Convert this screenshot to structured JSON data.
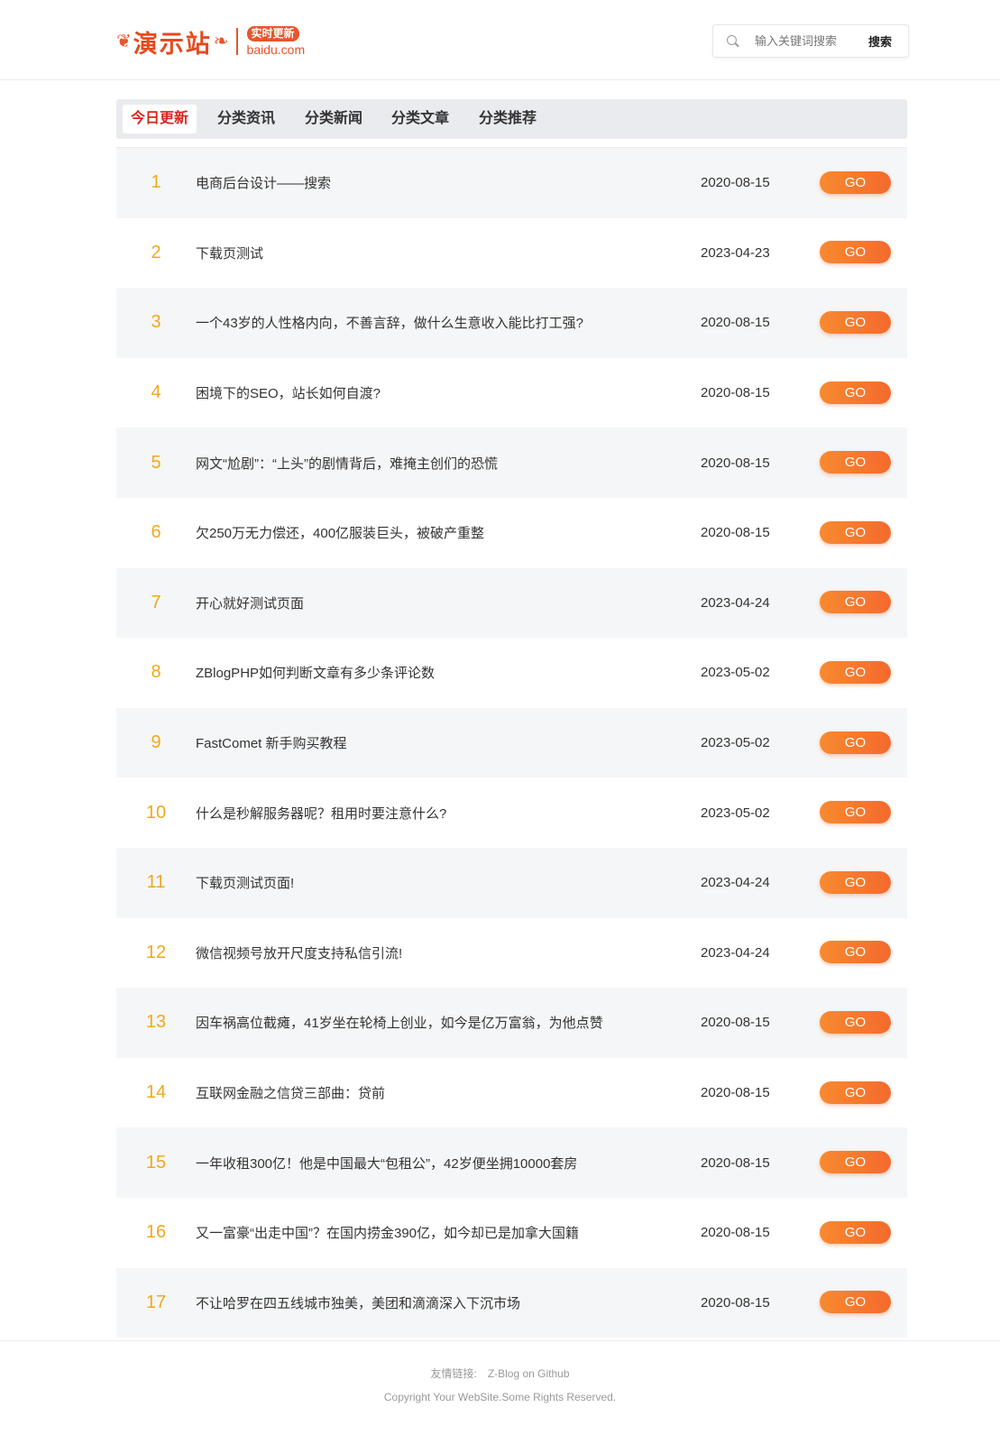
{
  "header": {
    "logo_text": "演示站",
    "logo_badge": "实时更新",
    "logo_domain": "baidu.com",
    "search_placeholder": "输入关键词搜索",
    "search_button": "搜索"
  },
  "tabs": [
    {
      "label": "今日更新",
      "active": true
    },
    {
      "label": "分类资讯",
      "active": false
    },
    {
      "label": "分类新闻",
      "active": false
    },
    {
      "label": "分类文章",
      "active": false
    },
    {
      "label": "分类推荐",
      "active": false
    }
  ],
  "articles": [
    {
      "rank": "1",
      "title": "电商后台设计——搜索",
      "date": "2020-08-15",
      "button": "GO"
    },
    {
      "rank": "2",
      "title": "下载页测试",
      "date": "2023-04-23",
      "button": "GO"
    },
    {
      "rank": "3",
      "title": "一个43岁的人性格内向，不善言辞，做什么生意收入能比打工强?",
      "date": "2020-08-15",
      "button": "GO"
    },
    {
      "rank": "4",
      "title": "困境下的SEO，站长如何自渡?",
      "date": "2020-08-15",
      "button": "GO"
    },
    {
      "rank": "5",
      "title": "网文“尬剧”：“上头”的剧情背后，难掩主创们的恐慌",
      "date": "2020-08-15",
      "button": "GO"
    },
    {
      "rank": "6",
      "title": "欠250万无力偿还，400亿服装巨头，被破产重整",
      "date": "2020-08-15",
      "button": "GO"
    },
    {
      "rank": "7",
      "title": "开心就好测试页面",
      "date": "2023-04-24",
      "button": "GO"
    },
    {
      "rank": "8",
      "title": "ZBlogPHP如何判断文章有多少条评论数",
      "date": "2023-05-02",
      "button": "GO"
    },
    {
      "rank": "9",
      "title": "FastComet 新手购买教程",
      "date": "2023-05-02",
      "button": "GO"
    },
    {
      "rank": "10",
      "title": "什么是秒解服务器呢？租用时要注意什么?",
      "date": "2023-05-02",
      "button": "GO"
    },
    {
      "rank": "11",
      "title": "下载页测试页面!",
      "date": "2023-04-24",
      "button": "GO"
    },
    {
      "rank": "12",
      "title": "微信视频号放开尺度支持私信引流!",
      "date": "2023-04-24",
      "button": "GO"
    },
    {
      "rank": "13",
      "title": "因车祸高位截瘫，41岁坐在轮椅上创业，如今是亿万富翁，为他点赞",
      "date": "2020-08-15",
      "button": "GO"
    },
    {
      "rank": "14",
      "title": "互联网金融之信贷三部曲：贷前",
      "date": "2020-08-15",
      "button": "GO"
    },
    {
      "rank": "15",
      "title": "一年收租300亿！他是中国最大“包租公”，42岁便坐拥10000套房",
      "date": "2020-08-15",
      "button": "GO"
    },
    {
      "rank": "16",
      "title": "又一富豪“出走中国”？在国内捞金390亿，如今却已是加拿大国籍",
      "date": "2020-08-15",
      "button": "GO"
    },
    {
      "rank": "17",
      "title": "不让哈罗在四五线城市独美，美团和滴滴深入下沉市场",
      "date": "2020-08-15",
      "button": "GO"
    }
  ],
  "footer": {
    "links_label": "友情链接:",
    "link_text": "Z-Blog on Github",
    "copyright": "Copyright Your WebSite.Some Rights Reserved."
  },
  "colors": {
    "brand": "#e8552b",
    "rank": "#f0a81c",
    "go_button": "#f46a2d",
    "active_tab": "#d9261c"
  }
}
